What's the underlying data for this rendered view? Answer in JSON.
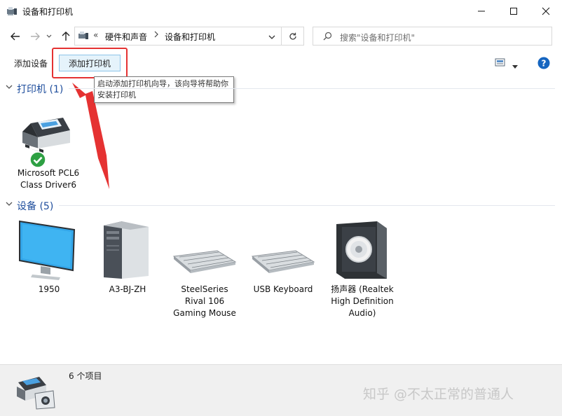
{
  "window": {
    "title": "设备和打印机",
    "minimize_icon": "minimize-icon",
    "maximize_icon": "maximize-icon",
    "close_icon": "close-icon"
  },
  "nav": {
    "back_icon": "arrow-left-icon",
    "forward_icon": "arrow-right-icon",
    "up_icon": "arrow-up-icon",
    "crumb_overflow": "«",
    "breadcrumbs": [
      "硬件和声音",
      "设备和打印机"
    ],
    "refresh_icon": "refresh-icon",
    "search_placeholder": "搜索\"设备和打印机\""
  },
  "toolbar": {
    "add_device": "添加设备",
    "add_printer": "添加打印机",
    "tooltip": "启动添加打印机向导，该向导将帮助你安装打印机"
  },
  "groups": {
    "printers": {
      "header": "打印机 (1)",
      "items": [
        {
          "line1": "Microsoft PCL6",
          "line2": "Class Driver6"
        }
      ]
    },
    "devices": {
      "header": "设备 (5)",
      "items": [
        {
          "line1": "1950"
        },
        {
          "line1": "A3-BJ-ZH"
        },
        {
          "line1": "SteelSeries",
          "line2": "Rival 106",
          "line3": "Gaming Mouse"
        },
        {
          "line1": "USB Keyboard"
        },
        {
          "line1": "扬声器 (Realtek",
          "line2": "High Definition",
          "line3": "Audio)"
        }
      ]
    }
  },
  "status": {
    "count": "6 个项目"
  },
  "watermark": "知乎 @不太正常的普通人",
  "colors": {
    "accent": "#1e4d9c",
    "highlight_red": "#e53232",
    "selected_bg": "#e5f3fb",
    "status_ok": "#2ea043"
  }
}
